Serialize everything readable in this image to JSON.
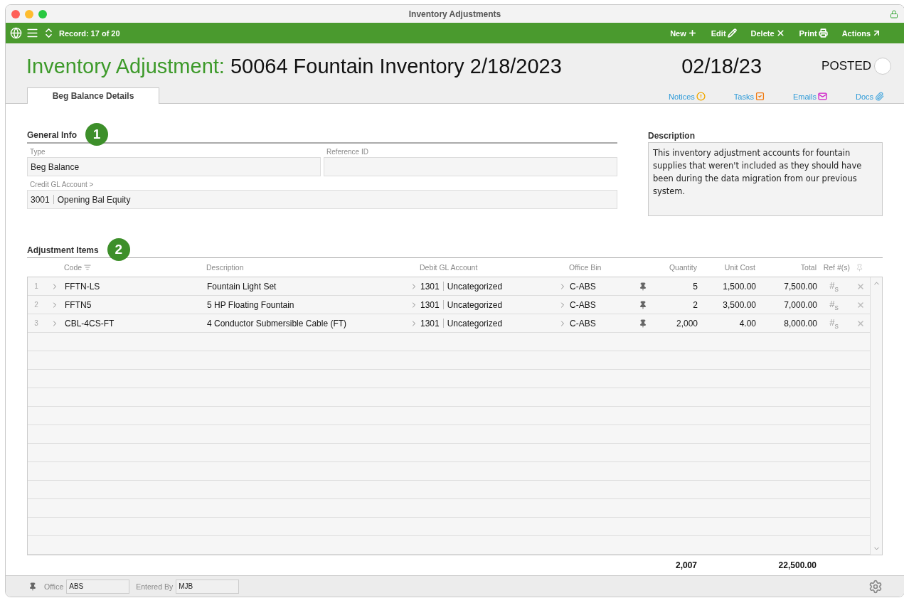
{
  "window": {
    "title": "Inventory Adjustments",
    "locked": true
  },
  "toolbar": {
    "record": "Record: 17 of 20",
    "actions": [
      {
        "label": "New",
        "kind": "new"
      },
      {
        "label": "Edit",
        "kind": "edit"
      },
      {
        "label": "Delete",
        "kind": "delete"
      },
      {
        "label": "Print",
        "kind": "print"
      },
      {
        "label": "Actions",
        "kind": "actions"
      }
    ]
  },
  "header": {
    "label": "Inventory Adjustment:",
    "name": "50064 Fountain Inventory 2/18/2023",
    "date": "02/18/23",
    "status_label": "POSTED",
    "posted": false
  },
  "tabs": [
    {
      "label": "Beg Balance Details",
      "selected": true
    }
  ],
  "links": [
    {
      "label": "Notices",
      "kind": "notices"
    },
    {
      "label": "Tasks",
      "kind": "tasks"
    },
    {
      "label": "Emails",
      "kind": "emails"
    },
    {
      "label": "Docs",
      "kind": "docs"
    }
  ],
  "general_info": {
    "title": "General Info",
    "badge": "1",
    "type_label": "Type",
    "type": "Beg Balance",
    "reference_label": "Reference ID",
    "account_label": "Credit GL Account >",
    "account_no": "3001",
    "account_name": "Opening Bal Equity"
  },
  "description": {
    "title": "Description",
    "text": "This inventory adjustment accounts for fountain supplies that weren't included as they should have been during the data migration from our previous system."
  },
  "items": {
    "title": "Adjustment Items",
    "badge": "2",
    "columns": {
      "code": "Code",
      "description": "Description",
      "account": "Debit GL Account",
      "bin": "Office Bin",
      "quantity": "Quantity",
      "unit_cost": "Unit Cost",
      "total": "Total",
      "ref": "Ref #(s)"
    },
    "rows": [
      {
        "num": "1",
        "code": "FFTN-LS",
        "description": "Fountain Light Set",
        "account_no": "1301",
        "account_name": "Uncategorized",
        "bin": "C-ABS",
        "quantity": "5",
        "unit_cost": "1,500.00",
        "total": "7,500.00",
        "ref": "#$_{s}$"
      },
      {
        "num": "2",
        "code": "FFTN5",
        "description": "5 HP Floating Fountain",
        "account_no": "1301",
        "account_name": "Uncategorized",
        "bin": "C-ABS",
        "quantity": "2",
        "unit_cost": "3,500.00",
        "total": "7,000.00",
        "ref": "#$_{s}$"
      },
      {
        "num": "3",
        "code": "CBL-4CS-FT",
        "description": "4 Conductor Submersible Cable (FT)",
        "account_no": "1301",
        "account_name": "Uncategorized",
        "bin": "C-ABS",
        "quantity": "2,000",
        "unit_cost": "4.00",
        "total": "8,000.00",
        "ref": "#$_{s}$"
      }
    ],
    "totals": {
      "quantity": "2,007",
      "total": "22,500.00"
    }
  },
  "footer": {
    "office_label": "Office",
    "office": "ABS",
    "entered_by_label": "Entered By",
    "entered_by": "MJB"
  }
}
